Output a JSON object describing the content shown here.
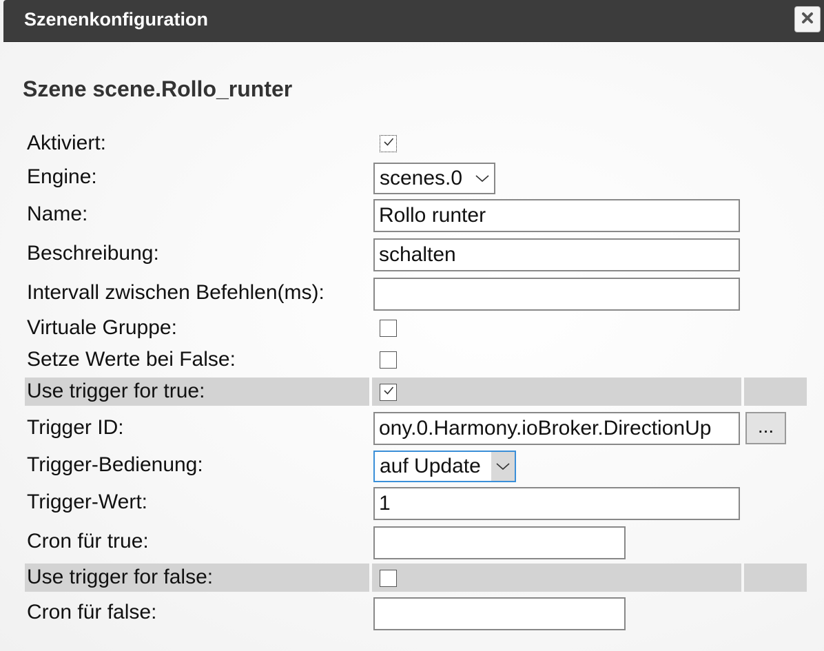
{
  "dialog": {
    "title": "Szenenkonfiguration"
  },
  "scene": {
    "heading": "Szene scene.Rollo_runter"
  },
  "labels": {
    "aktiviert": "Aktiviert:",
    "engine": "Engine:",
    "name": "Name:",
    "beschreibung": "Beschreibung:",
    "intervall": "Intervall zwischen Befehlen(ms):",
    "virtuale_gruppe": "Virtuale Gruppe:",
    "setze_werte": "Setze Werte bei False:",
    "use_trigger_true": "Use trigger for true:",
    "trigger_id": "Trigger ID:",
    "trigger_bedienung": "Trigger-Bedienung:",
    "trigger_wert": "Trigger-Wert:",
    "cron_true": "Cron für true:",
    "use_trigger_false": "Use trigger for false:",
    "cron_false": "Cron für false:"
  },
  "values": {
    "aktiviert": true,
    "engine": "scenes.0",
    "name": "Rollo runter",
    "beschreibung": "schalten",
    "intervall": "",
    "virtuale_gruppe": false,
    "setze_werte": false,
    "use_trigger_true": true,
    "trigger_id": "ony.0.Harmony.ioBroker.DirectionUp",
    "trigger_bedienung": "auf Update",
    "trigger_wert": "1",
    "cron_true": "",
    "use_trigger_false": false,
    "cron_false": ""
  },
  "buttons": {
    "browse_label": "..."
  },
  "icons": {
    "close": "close-icon",
    "checkmark": "checkmark-icon",
    "dropdown": "chevron-down-icon"
  },
  "colors": {
    "titlebar": "#3c3c3c",
    "highlight_row": "#d3d3d3",
    "focus_border": "#3a8fd8"
  }
}
